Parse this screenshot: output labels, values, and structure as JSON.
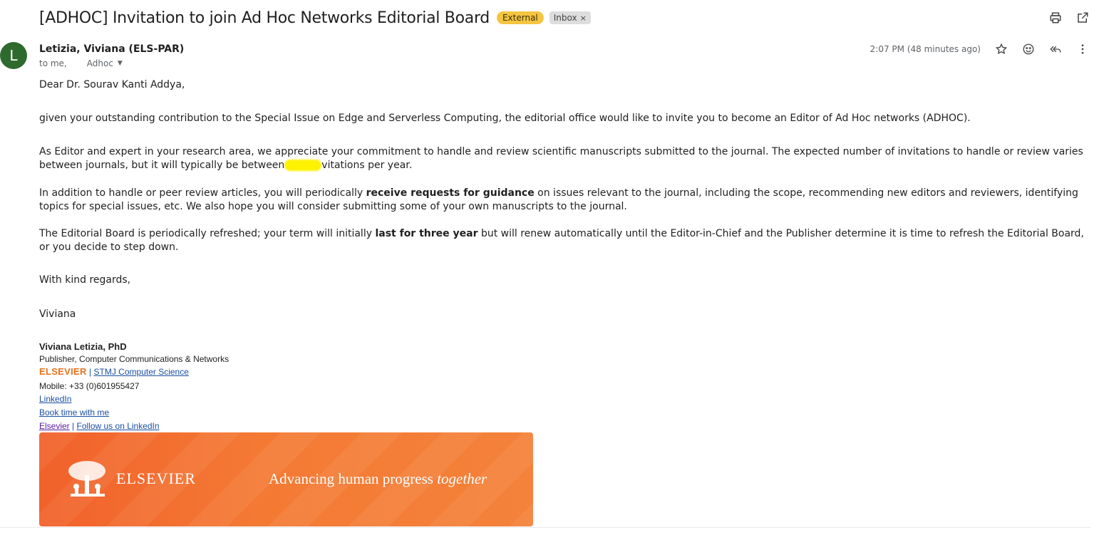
{
  "subject": "[ADHOC] Invitation to join Ad Hoc Networks Editorial Board",
  "labels": {
    "external": "External",
    "inbox": "Inbox",
    "inbox_remove": "×"
  },
  "sender": {
    "initial": "L",
    "name": "Letizia, Viviana (ELS-PAR)",
    "to": "to me,",
    "list": "Adhoc"
  },
  "timestamp": "2:07 PM (48 minutes ago)",
  "colors": {
    "external_chip": "#f5c542",
    "avatar": "#2e6a2e",
    "elsevier_orange": "#e9711c",
    "banner": "#f1612b",
    "highlight": "#fff200"
  },
  "icons": [
    "print-icon",
    "open-in-new-window-icon",
    "star-icon",
    "emoji-icon",
    "reply-all-icon",
    "more-vert-icon"
  ],
  "body": {
    "greeting": "Dear Dr. Sourav Kanti Addya,",
    "p1": "given your outstanding contribution to the Special Issue on Edge and Serverless Computing, the editorial office would like to invite you to become an Editor of Ad Hoc networks (ADHOC).",
    "p2a": "As Editor and expert in your research area, we appreciate your commitment to handle and review scientific manuscripts submitted to the journal. The expected number of invitations to handle or review varies between journals, but it will typically be between",
    "p2b": "vitations per year.",
    "p3a": "In addition to handle or peer review articles, you will periodically",
    "p3b": "receive requests for guidance",
    "p3c": "on issues relevant to the journal, including the scope, recommending new editors and reviewers, identifying topics for special issues, etc. We also hope you will consider submitting some of your own manuscripts to the journal.",
    "p4a": "The Editorial Board is periodically refreshed; your term will initially",
    "p4b": "last for three year",
    "p4c": "but will renew automatically until the Editor-in-Chief and the Publisher determine it is time to refresh the Editorial Board, or you decide to step down.",
    "closing": "With kind regards,",
    "signoff": "Viviana"
  },
  "signature": {
    "name": "Viviana Letizia, PhD",
    "title": "Publisher, Computer Communications & Networks",
    "brand": "ELSEVIER",
    "sep": "|",
    "stmj": "STMJ Computer Science",
    "mobile": "Mobile: +33 (0)601955427",
    "linkedin": "LinkedIn",
    "book": "Book time with me",
    "elsevier_link": "Elsevier",
    "follow": "Follow us on LinkedIn"
  },
  "banner": {
    "wordmark": "ELSEVIER",
    "tagline_plain": "Advancing human progress",
    "tagline_italic": "together"
  }
}
